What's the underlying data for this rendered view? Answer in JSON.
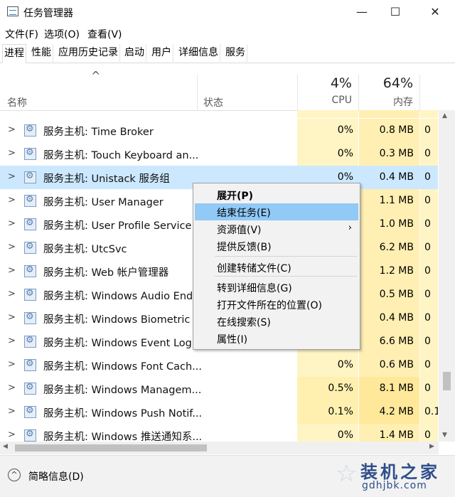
{
  "window": {
    "title": "任务管理器",
    "minimize": "—",
    "maximize": "☐",
    "close": "✕"
  },
  "menu": [
    "文件(F)",
    "选项(O)",
    "查看(V)"
  ],
  "tabs": [
    "进程",
    "性能",
    "应用历史记录",
    "启动",
    "用户",
    "详细信息",
    "服务"
  ],
  "active_tab": "进程",
  "columns": {
    "name": "名称",
    "status": "状态",
    "cpu_pct": "4%",
    "cpu": "CPU",
    "mem_pct": "64%",
    "mem": "内存",
    "sort_arrow": "^"
  },
  "rows": [
    {
      "name": "服务主机: Time Broker",
      "cpu": "0%",
      "mem": "0.8 MB",
      "disk": "0"
    },
    {
      "name": "服务主机: Touch Keyboard an...",
      "cpu": "0%",
      "mem": "0.3 MB",
      "disk": "0"
    },
    {
      "name": "服务主机: Unistack 服务组",
      "cpu": "0%",
      "mem": "0.4 MB",
      "disk": "0",
      "selected": true
    },
    {
      "name": "服务主机: User Manager",
      "cpu": "",
      "mem": "1.1 MB",
      "disk": "0"
    },
    {
      "name": "服务主机: User Profile Service",
      "cpu": "",
      "mem": "1.0 MB",
      "disk": "0"
    },
    {
      "name": "服务主机: UtcSvc",
      "cpu": "",
      "mem": "6.2 MB",
      "disk": "0"
    },
    {
      "name": "服务主机: Web 帐户管理器",
      "cpu": "",
      "mem": "1.2 MB",
      "disk": "0"
    },
    {
      "name": "服务主机: Windows Audio End...",
      "cpu": "",
      "mem": "0.5 MB",
      "disk": "0"
    },
    {
      "name": "服务主机: Windows Biometric ...",
      "cpu": "",
      "mem": "0.4 MB",
      "disk": "0"
    },
    {
      "name": "服务主机: Windows Event Log",
      "cpu": "",
      "mem": "6.6 MB",
      "disk": "0"
    },
    {
      "name": "服务主机: Windows Font Cach...",
      "cpu": "0%",
      "mem": "0.6 MB",
      "disk": "0"
    },
    {
      "name": "服务主机: Windows Managem...",
      "cpu": "0.5%",
      "mem": "8.1 MB",
      "disk": "0"
    },
    {
      "name": "服务主机: Windows Push Notif...",
      "cpu": "0.1%",
      "mem": "4.2 MB",
      "disk": "0.1"
    },
    {
      "name": "服务主机: Windows 推送通知系...",
      "cpu": "0%",
      "mem": "1.4 MB",
      "disk": "0"
    }
  ],
  "context_menu": [
    {
      "label": "展开(P)",
      "bold": true
    },
    {
      "label": "结束任务(E)",
      "highlighted": true
    },
    {
      "label": "资源值(V)",
      "submenu": true,
      "arrow": "›"
    },
    {
      "label": "提供反馈(B)"
    },
    {
      "label": "创建转储文件(C)"
    },
    {
      "label": "转到详细信息(G)"
    },
    {
      "label": "打开文件所在的位置(O)"
    },
    {
      "label": "在线搜索(S)"
    },
    {
      "label": "属性(I)"
    }
  ],
  "status_bar": {
    "fewer_details": "简略信息(D)",
    "icon": "^"
  },
  "watermark": {
    "line1": "装机之家",
    "line2": "gdhjbk.com"
  },
  "colors": {
    "selected_row": "#cce8ff",
    "cpu_heat": "#fff4c4",
    "mem_heat": "#ffefb3",
    "menu_highlight": "#91c9f7"
  }
}
